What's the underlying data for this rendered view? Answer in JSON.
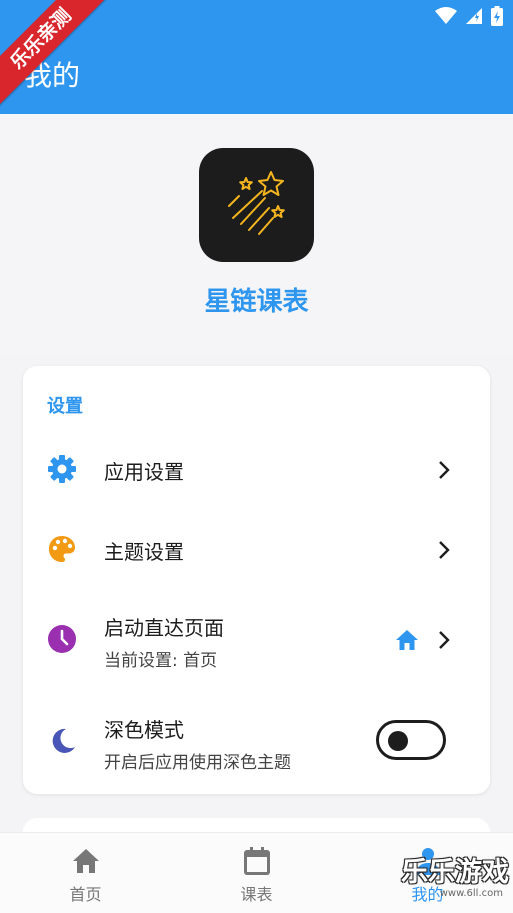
{
  "header": {
    "title": "我的"
  },
  "ribbon": {
    "text": "乐乐亲测"
  },
  "statusbar": {
    "icons": [
      "wifi-icon",
      "signal-icon",
      "battery-icon"
    ]
  },
  "profile": {
    "app_name": "星链课表",
    "logo_icon": "shooting-stars-icon"
  },
  "settings": {
    "section_title": "设置",
    "items": [
      {
        "icon": "gear-icon",
        "icon_color": "#2f96ef",
        "label": "应用设置"
      },
      {
        "icon": "palette-icon",
        "icon_color": "#f39a14",
        "label": "主题设置"
      },
      {
        "icon": "clock-icon",
        "icon_color": "#9a2fb0",
        "label": "启动直达页面",
        "sub": "当前设置: 首页",
        "indicator_icon": "home-icon"
      },
      {
        "icon": "moon-icon",
        "icon_color": "#4a55b8",
        "label": "深色模式",
        "sub": "开启后应用使用深色主题",
        "toggle_on": false
      }
    ]
  },
  "bottom_nav": {
    "items": [
      {
        "label": "首页",
        "icon": "home-icon",
        "active": false
      },
      {
        "label": "课表",
        "icon": "calendar-icon",
        "active": false
      },
      {
        "label": "我的",
        "icon": "person-icon",
        "active": true
      }
    ]
  },
  "watermark": {
    "text": "乐乐游戏",
    "url": "www.6ll.com"
  },
  "colors": {
    "primary": "#2f96ef",
    "ribbon": "#d8262c",
    "logo_bg": "#1c1c1c",
    "logo_star": "#f4b51f"
  }
}
